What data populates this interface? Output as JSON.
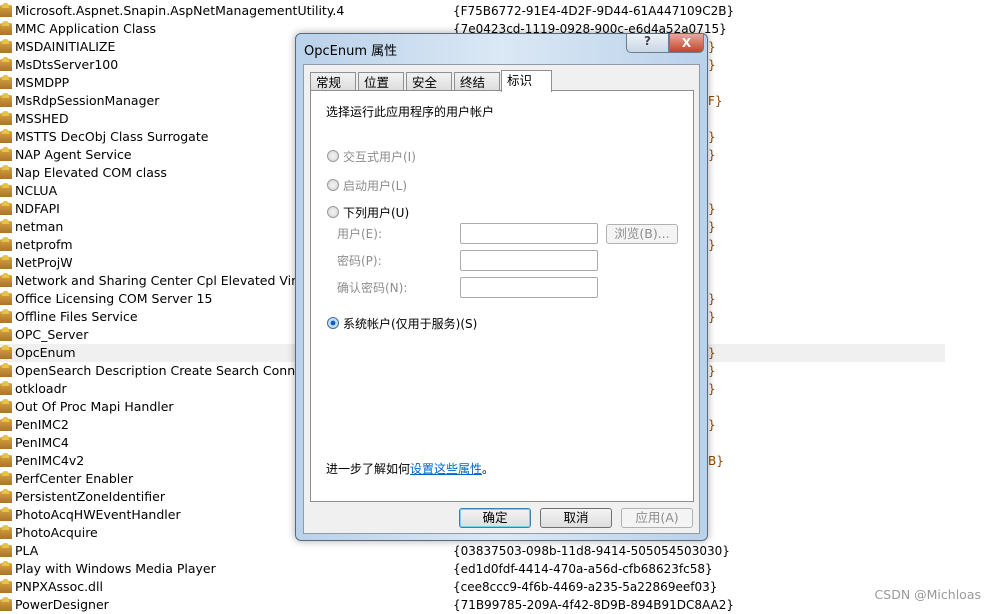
{
  "list": {
    "rows": [
      {
        "name": "Microsoft.Aspnet.Snapin.AspNetManagementUtility.4",
        "guid": "{F75B6772-91E4-4D2F-9D44-61A447109C2B}"
      },
      {
        "name": "MMC Application Class",
        "guid": "{7e0423cd-1119-0928-900c-e6d4a52a0715}"
      },
      {
        "name": "MSDAINITIALIZE",
        "guid": ""
      },
      {
        "name": "MsDtsServer100",
        "guid": ""
      },
      {
        "name": "MSMDPP",
        "guid": ""
      },
      {
        "name": "MsRdpSessionManager",
        "guid": ""
      },
      {
        "name": "MSSHED",
        "guid": ""
      },
      {
        "name": "MSTTS DecObj Class Surrogate",
        "guid": ""
      },
      {
        "name": "NAP Agent Service",
        "guid": ""
      },
      {
        "name": "Nap Elevated COM class",
        "guid": ""
      },
      {
        "name": "NCLUA",
        "guid": ""
      },
      {
        "name": "NDFAPI",
        "guid": ""
      },
      {
        "name": "netman",
        "guid": ""
      },
      {
        "name": "netprofm",
        "guid": ""
      },
      {
        "name": "NetProjW",
        "guid": ""
      },
      {
        "name": "Network and Sharing Center Cpl Elevated Virtua",
        "guid": ""
      },
      {
        "name": "Office Licensing COM Server 15",
        "guid": ""
      },
      {
        "name": "Offline Files Service",
        "guid": ""
      },
      {
        "name": "OPC_Server",
        "guid": ""
      },
      {
        "name": "OpcEnum",
        "guid": "",
        "selected": true
      },
      {
        "name": "OpenSearch Description Create Search Connecto",
        "guid": ""
      },
      {
        "name": "otkloadr",
        "guid": ""
      },
      {
        "name": "Out Of Proc Mapi Handler",
        "guid": ""
      },
      {
        "name": "PenIMC2",
        "guid": ""
      },
      {
        "name": "PenIMC4",
        "guid": ""
      },
      {
        "name": "PenIMC4v2",
        "guid": ""
      },
      {
        "name": "PerfCenter Enabler",
        "guid": ""
      },
      {
        "name": "PersistentZoneIdentifier",
        "guid": ""
      },
      {
        "name": "PhotoAcqHWEventHandler",
        "guid": ""
      },
      {
        "name": "PhotoAcquire",
        "guid": ""
      },
      {
        "name": "PLA",
        "guid": "{03837503-098b-11d8-9414-505054503030}"
      },
      {
        "name": "Play with Windows Media Player",
        "guid": "{ed1d0fdf-4414-470a-a56d-cfb68623fc58}"
      },
      {
        "name": "PNPXAssoc.dll",
        "guid": "{cee8ccc9-4f6b-4469-a235-5a22869eef03}"
      },
      {
        "name": "PowerDesigner",
        "guid": "{71B99785-209A-4f42-8D9B-894B91DC8AA2}"
      }
    ],
    "fragments": [
      {
        "row": 2,
        "text": "}"
      },
      {
        "row": 3,
        "text": "}"
      },
      {
        "row": 5,
        "text": "F}"
      },
      {
        "row": 7,
        "text": "}"
      },
      {
        "row": 8,
        "text": "}"
      },
      {
        "row": 11,
        "text": "}"
      },
      {
        "row": 12,
        "text": "}"
      },
      {
        "row": 13,
        "text": "}"
      },
      {
        "row": 16,
        "text": "}"
      },
      {
        "row": 17,
        "text": "}"
      },
      {
        "row": 19,
        "text": "}"
      },
      {
        "row": 20,
        "text": "}"
      },
      {
        "row": 21,
        "text": "}"
      },
      {
        "row": 23,
        "text": "}"
      },
      {
        "row": 25,
        "text": "B}"
      }
    ]
  },
  "dialog": {
    "title": "OpcEnum 属性",
    "help_label": "?",
    "close_label": "X",
    "tabs": [
      "常规",
      "位置",
      "安全",
      "终结点",
      "标识"
    ],
    "active_tab": "标识",
    "heading": "选择运行此应用程序的用户帐户",
    "options": {
      "interactive": "交互式用户(I)",
      "launching": "启动用户(L)",
      "this_user": "下列用户(U)",
      "system": "系统帐户(仅用于服务)(S)"
    },
    "selected_option": "system",
    "fields": {
      "user_label": "用户(E):",
      "password_label": "密码(P):",
      "confirm_label": "确认密码(N):",
      "user_value": "",
      "password_value": "",
      "confirm_value": "",
      "browse_label": "浏览(B)..."
    },
    "learn_more_prefix": "进一步了解如何",
    "learn_more_link": "设置这些属性",
    "learn_more_suffix": "。",
    "buttons": {
      "ok": "确定",
      "cancel": "取消",
      "apply": "应用(A)"
    }
  },
  "watermark": "CSDN @Michloas",
  "colors": {
    "link": "#0066cc",
    "selected_row": "#f0f0f0",
    "close_button": "#c4432b"
  }
}
